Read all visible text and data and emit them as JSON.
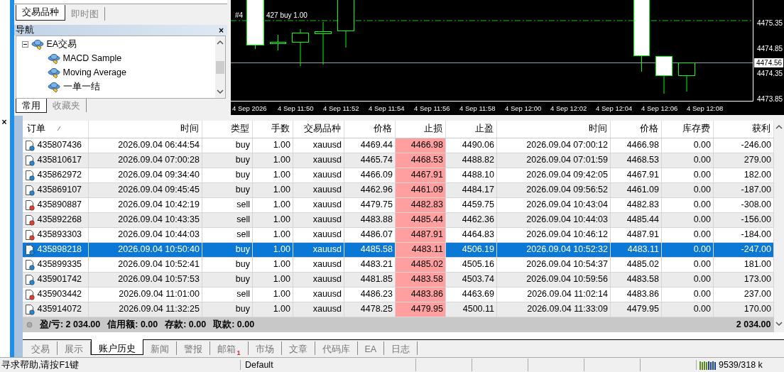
{
  "left_panel": {
    "tabs": [
      {
        "label": "交易品种",
        "selected": true
      },
      {
        "label": "即时图",
        "selected": false
      }
    ]
  },
  "navigator": {
    "title": "导航",
    "close": "×",
    "tree": [
      {
        "label": "EA交易",
        "expanded": true,
        "children": [
          {
            "label": "MACD Sample"
          },
          {
            "label": "Moving Average"
          },
          {
            "label": "一单一结"
          }
        ]
      }
    ],
    "tabs": [
      {
        "label": "常用",
        "selected": true
      },
      {
        "label": "收藏夹",
        "selected": false
      }
    ]
  },
  "chart": {
    "order_label": [
      "#4",
      "427 buy 1.00"
    ],
    "price_labels": [
      "4475.35",
      "4474.85",
      "4474.35",
      "4473.85"
    ],
    "current_price": "4474.56",
    "time_labels": [
      "4 Sep 2026",
      "4 Sep 11:50",
      "4 Sep 11:52",
      "4 Sep 11:54",
      "4 Sep 11:56",
      "4 Sep 11:58",
      "4 Sep 12:00",
      "4 Sep 12:02",
      "4 Sep 12:04",
      "4 Sep 12:06",
      "4 Sep 12:08"
    ]
  },
  "terminal": {
    "close": "×",
    "table": {
      "columns": [
        "订单",
        "时间",
        "类型",
        "手数",
        "交易品种",
        "价格",
        "止损",
        "止盈",
        "时间",
        "价格",
        "库存费",
        "获利"
      ],
      "rows": [
        {
          "kind": "buy",
          "selected": false,
          "cells": [
            "435807436",
            "2026.09.04 06:44:54",
            "buy",
            "1.00",
            "xauusd",
            "4469.44",
            "4466.98",
            "4490.06",
            "2026.09.04 07:00:12",
            "4466.98",
            "0.00",
            "-246.00"
          ]
        },
        {
          "kind": "buy",
          "selected": false,
          "cells": [
            "435810617",
            "2026.09.04 07:00:28",
            "buy",
            "1.00",
            "xauusd",
            "4465.74",
            "4468.53",
            "4488.82",
            "2026.09.04 07:01:59",
            "4468.53",
            "0.00",
            "279.00"
          ]
        },
        {
          "kind": "buy",
          "selected": false,
          "cells": [
            "435862972",
            "2026.09.04 09:34:40",
            "buy",
            "1.00",
            "xauusd",
            "4466.09",
            "4467.91",
            "4488.10",
            "2026.09.04 09:42:05",
            "4467.91",
            "0.00",
            "182.00"
          ]
        },
        {
          "kind": "buy",
          "selected": false,
          "cells": [
            "435869107",
            "2026.09.04 09:45:45",
            "buy",
            "1.00",
            "xauusd",
            "4462.96",
            "4461.09",
            "4484.17",
            "2026.09.04 09:56:52",
            "4461.09",
            "0.00",
            "-187.00"
          ]
        },
        {
          "kind": "sell",
          "selected": false,
          "cells": [
            "435890887",
            "2026.09.04 10:42:19",
            "sell",
            "1.00",
            "xauusd",
            "4479.75",
            "4482.83",
            "4459.75",
            "2026.09.04 10:43:04",
            "4482.83",
            "0.00",
            "-308.00"
          ]
        },
        {
          "kind": "sell",
          "selected": false,
          "cells": [
            "435892268",
            "2026.09.04 10:43:35",
            "sell",
            "1.00",
            "xauusd",
            "4483.88",
            "4485.44",
            "4462.36",
            "2026.09.04 10:44:03",
            "4485.44",
            "0.00",
            "-156.00"
          ]
        },
        {
          "kind": "sell",
          "selected": false,
          "cells": [
            "435893303",
            "2026.09.04 10:44:03",
            "sell",
            "1.00",
            "xauusd",
            "4486.07",
            "4487.91",
            "4464.83",
            "2026.09.04 10:46:12",
            "4487.91",
            "0.00",
            "-184.00"
          ]
        },
        {
          "kind": "buy",
          "selected": true,
          "cells": [
            "435898218",
            "2026.09.04 10:50:40",
            "buy",
            "1.00",
            "xauusd",
            "4485.58",
            "4483.11",
            "4506.19",
            "2026.09.04 10:52:32",
            "4483.11",
            "0.00",
            "-247.00"
          ]
        },
        {
          "kind": "buy",
          "selected": false,
          "cells": [
            "435899335",
            "2026.09.04 10:52:41",
            "buy",
            "1.00",
            "xauusd",
            "4483.21",
            "4485.02",
            "4505.16",
            "2026.09.04 10:54:37",
            "4485.02",
            "0.00",
            "181.00"
          ]
        },
        {
          "kind": "buy",
          "selected": false,
          "cells": [
            "435901742",
            "2026.09.04 10:57:53",
            "buy",
            "1.00",
            "xauusd",
            "4481.85",
            "4483.58",
            "4503.74",
            "2026.09.04 10:59:56",
            "4483.58",
            "0.00",
            "173.00"
          ]
        },
        {
          "kind": "sell",
          "selected": false,
          "cells": [
            "435903442",
            "2026.09.04 11:01:00",
            "sell",
            "1.00",
            "xauusd",
            "4486.23",
            "4483.86",
            "4463.69",
            "2026.09.04 11:02:14",
            "4483.86",
            "0.00",
            "237.00"
          ]
        },
        {
          "kind": "buy",
          "selected": false,
          "cells": [
            "435914072",
            "2026.09.04 11:32:25",
            "buy",
            "1.00",
            "xauusd",
            "4478.25",
            "4479.95",
            "4500.11",
            "2026.09.04 11:33:09",
            "4479.95",
            "0.00",
            "170.00"
          ]
        }
      ]
    },
    "summary": {
      "items": [
        "盈/亏: 2 034.00",
        "信用额: 0.00",
        "存款: 0.00",
        "取款: 0.00"
      ],
      "total": "2 034.00"
    },
    "tabs": [
      {
        "label": "交易",
        "selected": false
      },
      {
        "label": "展示",
        "selected": false
      },
      {
        "label": "账户历史",
        "selected": true
      },
      {
        "label": "新闻",
        "selected": false
      },
      {
        "label": "警报",
        "selected": false
      },
      {
        "label": "邮箱",
        "selected": false,
        "badge": "1"
      },
      {
        "label": "市场",
        "selected": false
      },
      {
        "label": "文章",
        "selected": false
      },
      {
        "label": "代码库",
        "selected": false
      },
      {
        "label": "EA",
        "selected": false
      },
      {
        "label": "日志",
        "selected": false
      }
    ]
  },
  "status_bar": {
    "help": "寻求帮助,请按F1键",
    "profile": "Default",
    "traffic": "9539/318 k"
  }
}
